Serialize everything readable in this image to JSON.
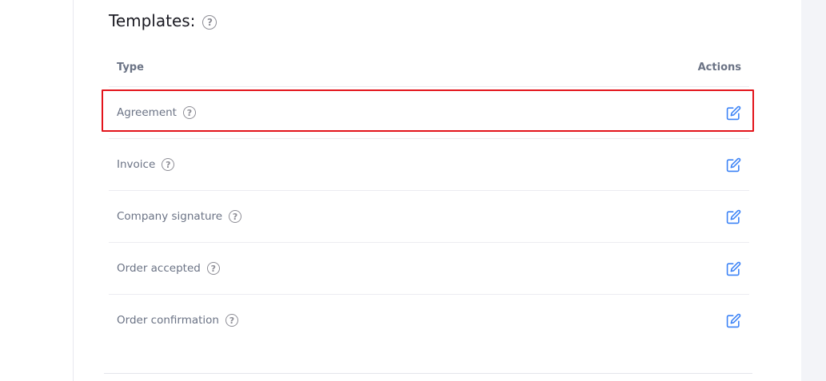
{
  "section": {
    "title": "Templates:"
  },
  "table": {
    "header": {
      "type": "Type",
      "actions": "Actions"
    },
    "rows": [
      {
        "label": "Agreement",
        "action_icon": "edit-icon"
      },
      {
        "label": "Invoice",
        "action_icon": "edit-icon"
      },
      {
        "label": "Company signature",
        "action_icon": "edit-icon"
      },
      {
        "label": "Order accepted",
        "action_icon": "edit-icon"
      },
      {
        "label": "Order confirmation",
        "action_icon": "edit-icon"
      }
    ]
  },
  "help_icon_glyph": "?",
  "colors": {
    "edit_icon": "#3b82f6",
    "highlight": "#e3141b",
    "text_muted": "#6b7385",
    "title": "#1a1a22"
  }
}
